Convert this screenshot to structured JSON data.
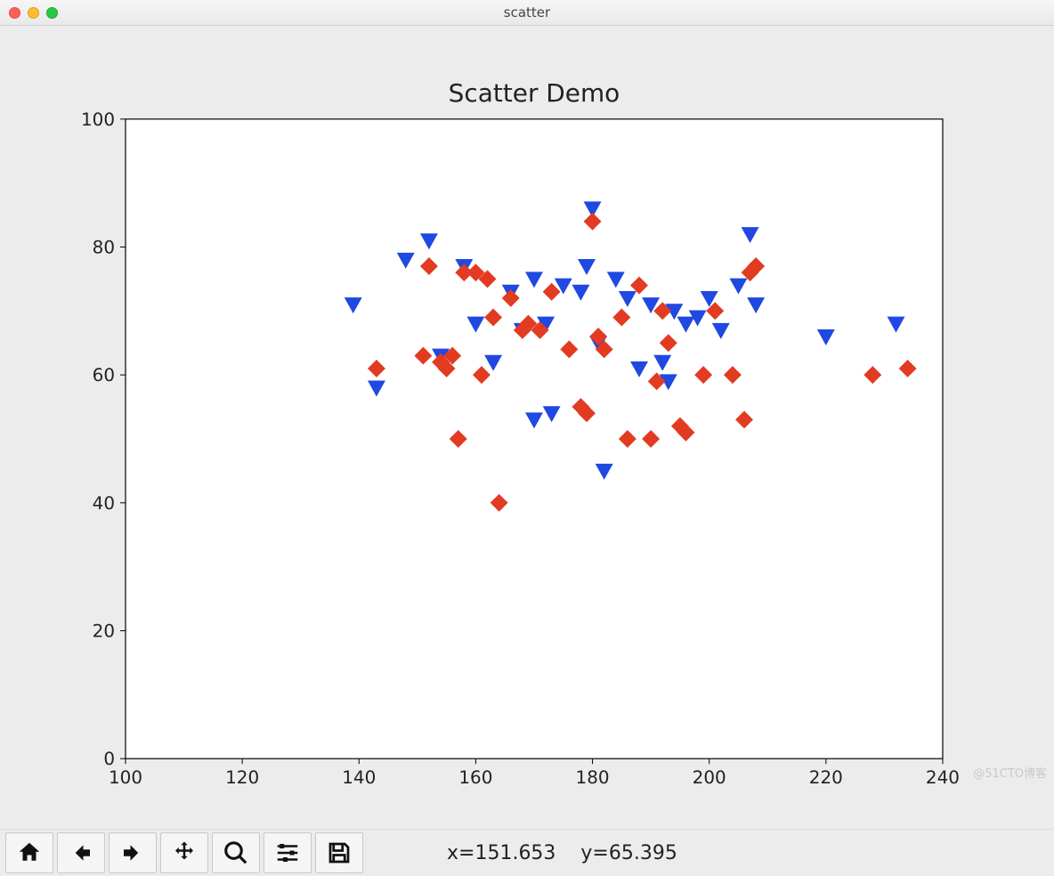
{
  "window": {
    "title": "scatter"
  },
  "chart_data": {
    "type": "scatter",
    "title": "Scatter Demo",
    "xlabel": "",
    "ylabel": "",
    "xlim": [
      100,
      240
    ],
    "ylim": [
      0,
      100
    ],
    "xticks": [
      100,
      120,
      140,
      160,
      180,
      200,
      220,
      240
    ],
    "yticks": [
      0,
      20,
      40,
      60,
      80,
      100
    ],
    "series": [
      {
        "name": "blue",
        "marker": "triangle-down",
        "color": "#1f49e0",
        "points": [
          {
            "x": 139,
            "y": 71
          },
          {
            "x": 143,
            "y": 58
          },
          {
            "x": 148,
            "y": 78
          },
          {
            "x": 152,
            "y": 81
          },
          {
            "x": 154,
            "y": 63
          },
          {
            "x": 158,
            "y": 77
          },
          {
            "x": 160,
            "y": 68
          },
          {
            "x": 163,
            "y": 62
          },
          {
            "x": 166,
            "y": 73
          },
          {
            "x": 168,
            "y": 67
          },
          {
            "x": 170,
            "y": 75
          },
          {
            "x": 170,
            "y": 53
          },
          {
            "x": 172,
            "y": 68
          },
          {
            "x": 173,
            "y": 54
          },
          {
            "x": 175,
            "y": 74
          },
          {
            "x": 178,
            "y": 73
          },
          {
            "x": 179,
            "y": 77
          },
          {
            "x": 180,
            "y": 86
          },
          {
            "x": 181,
            "y": 65
          },
          {
            "x": 182,
            "y": 45
          },
          {
            "x": 184,
            "y": 75
          },
          {
            "x": 186,
            "y": 72
          },
          {
            "x": 188,
            "y": 61
          },
          {
            "x": 190,
            "y": 71
          },
          {
            "x": 192,
            "y": 62
          },
          {
            "x": 193,
            "y": 59
          },
          {
            "x": 194,
            "y": 70
          },
          {
            "x": 196,
            "y": 68
          },
          {
            "x": 198,
            "y": 69
          },
          {
            "x": 200,
            "y": 72
          },
          {
            "x": 202,
            "y": 67
          },
          {
            "x": 205,
            "y": 74
          },
          {
            "x": 207,
            "y": 82
          },
          {
            "x": 208,
            "y": 71
          },
          {
            "x": 220,
            "y": 66
          },
          {
            "x": 232,
            "y": 68
          }
        ]
      },
      {
        "name": "red",
        "marker": "diamond",
        "color": "#e23b22",
        "points": [
          {
            "x": 143,
            "y": 61
          },
          {
            "x": 151,
            "y": 63
          },
          {
            "x": 152,
            "y": 77
          },
          {
            "x": 154,
            "y": 62
          },
          {
            "x": 155,
            "y": 61
          },
          {
            "x": 156,
            "y": 63
          },
          {
            "x": 157,
            "y": 50
          },
          {
            "x": 158,
            "y": 76
          },
          {
            "x": 160,
            "y": 76
          },
          {
            "x": 161,
            "y": 60
          },
          {
            "x": 162,
            "y": 75
          },
          {
            "x": 163,
            "y": 69
          },
          {
            "x": 164,
            "y": 40
          },
          {
            "x": 166,
            "y": 72
          },
          {
            "x": 168,
            "y": 67
          },
          {
            "x": 169,
            "y": 68
          },
          {
            "x": 171,
            "y": 67
          },
          {
            "x": 173,
            "y": 73
          },
          {
            "x": 176,
            "y": 64
          },
          {
            "x": 178,
            "y": 55
          },
          {
            "x": 179,
            "y": 54
          },
          {
            "x": 180,
            "y": 84
          },
          {
            "x": 181,
            "y": 66
          },
          {
            "x": 182,
            "y": 64
          },
          {
            "x": 185,
            "y": 69
          },
          {
            "x": 186,
            "y": 50
          },
          {
            "x": 188,
            "y": 74
          },
          {
            "x": 190,
            "y": 50
          },
          {
            "x": 191,
            "y": 59
          },
          {
            "x": 192,
            "y": 70
          },
          {
            "x": 193,
            "y": 65
          },
          {
            "x": 195,
            "y": 52
          },
          {
            "x": 196,
            "y": 51
          },
          {
            "x": 199,
            "y": 60
          },
          {
            "x": 201,
            "y": 70
          },
          {
            "x": 204,
            "y": 60
          },
          {
            "x": 206,
            "y": 53
          },
          {
            "x": 207,
            "y": 76
          },
          {
            "x": 208,
            "y": 77
          },
          {
            "x": 228,
            "y": 60
          },
          {
            "x": 234,
            "y": 61
          }
        ]
      }
    ]
  },
  "toolbar": {
    "buttons": {
      "home": "Home",
      "back": "Back",
      "forward": "Forward",
      "pan": "Pan",
      "zoom": "Zoom",
      "configure": "Configure",
      "save": "Save"
    }
  },
  "status": {
    "text": "x=151.653    y=65.395"
  },
  "watermark": "@51CTO博客"
}
